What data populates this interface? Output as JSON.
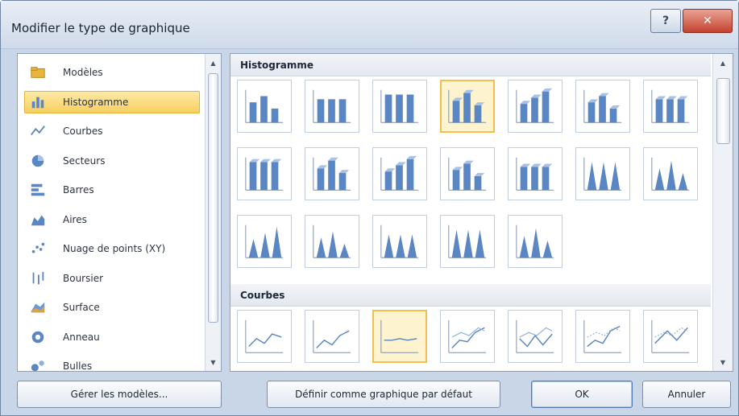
{
  "dialog": {
    "title": "Modifier le type de graphique",
    "help_symbol": "?",
    "close_symbol": "✕"
  },
  "chart_types": [
    {
      "label": "Modèles",
      "icon": "folder-icon",
      "selected": false
    },
    {
      "label": "Histogramme",
      "icon": "column-chart-icon",
      "selected": true
    },
    {
      "label": "Courbes",
      "icon": "line-chart-icon",
      "selected": false
    },
    {
      "label": "Secteurs",
      "icon": "pie-chart-icon",
      "selected": false
    },
    {
      "label": "Barres",
      "icon": "bar-chart-icon",
      "selected": false
    },
    {
      "label": "Aires",
      "icon": "area-chart-icon",
      "selected": false
    },
    {
      "label": "Nuage de points (XY)",
      "icon": "scatter-chart-icon",
      "selected": false
    },
    {
      "label": "Boursier",
      "icon": "stock-chart-icon",
      "selected": false
    },
    {
      "label": "Surface",
      "icon": "surface-chart-icon",
      "selected": false
    },
    {
      "label": "Anneau",
      "icon": "doughnut-chart-icon",
      "selected": false
    },
    {
      "label": "Bulles",
      "icon": "bubble-chart-icon",
      "selected": false
    }
  ],
  "sections": [
    {
      "name": "Histogramme",
      "thumb_count": 19,
      "selected_index": 3
    },
    {
      "name": "Courbes",
      "thumb_count": 7,
      "selected_index": 2
    }
  ],
  "buttons": {
    "manage_templates": "Gérer les modèles...",
    "set_default": "Définir comme graphique par défaut",
    "ok": "OK",
    "cancel": "Annuler"
  },
  "colors": {
    "selection_fill": "#f8cf60",
    "selection_border": "#f2c04d",
    "chart_blue": "#5b86c4",
    "frame": "#c9d6e7"
  }
}
